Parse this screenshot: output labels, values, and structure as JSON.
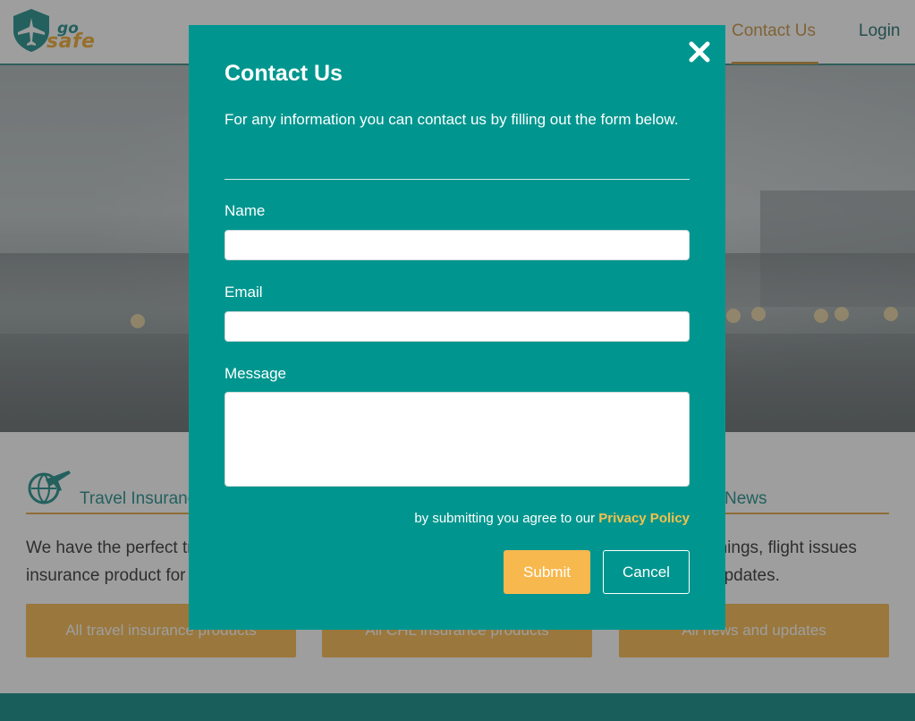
{
  "brand": {
    "logo_go": "go",
    "logo_safe": "safe",
    "teal": "#00968f",
    "accent": "#f7b84d"
  },
  "nav": {
    "contact": "Contact Us",
    "login": "Login"
  },
  "cards": [
    {
      "title": "Travel Insurance",
      "text_line1": "We have the perfect travel",
      "text_line2": "insurance product for you",
      "button": "All travel insurance products",
      "icon": "globe-plane-icon"
    },
    {
      "title": "",
      "text_line1": "",
      "text_line2": "",
      "button": "All CHL insurance products"
    },
    {
      "title": "News",
      "text_line1": "warnings, flight issues",
      "text_line2": "updates.",
      "button": "All news and updates"
    }
  ],
  "modal": {
    "title": "Contact Us",
    "intro": "For any information you can contact us by filling out the form below.",
    "fields": {
      "name_label": "Name",
      "name_value": "",
      "email_label": "Email",
      "email_value": "",
      "message_label": "Message",
      "message_value": ""
    },
    "agree_text": "by submitting you agree to our ",
    "privacy_link": "Privacy Policy",
    "submit": "Submit",
    "cancel": "Cancel",
    "close_icon": "close-icon"
  }
}
